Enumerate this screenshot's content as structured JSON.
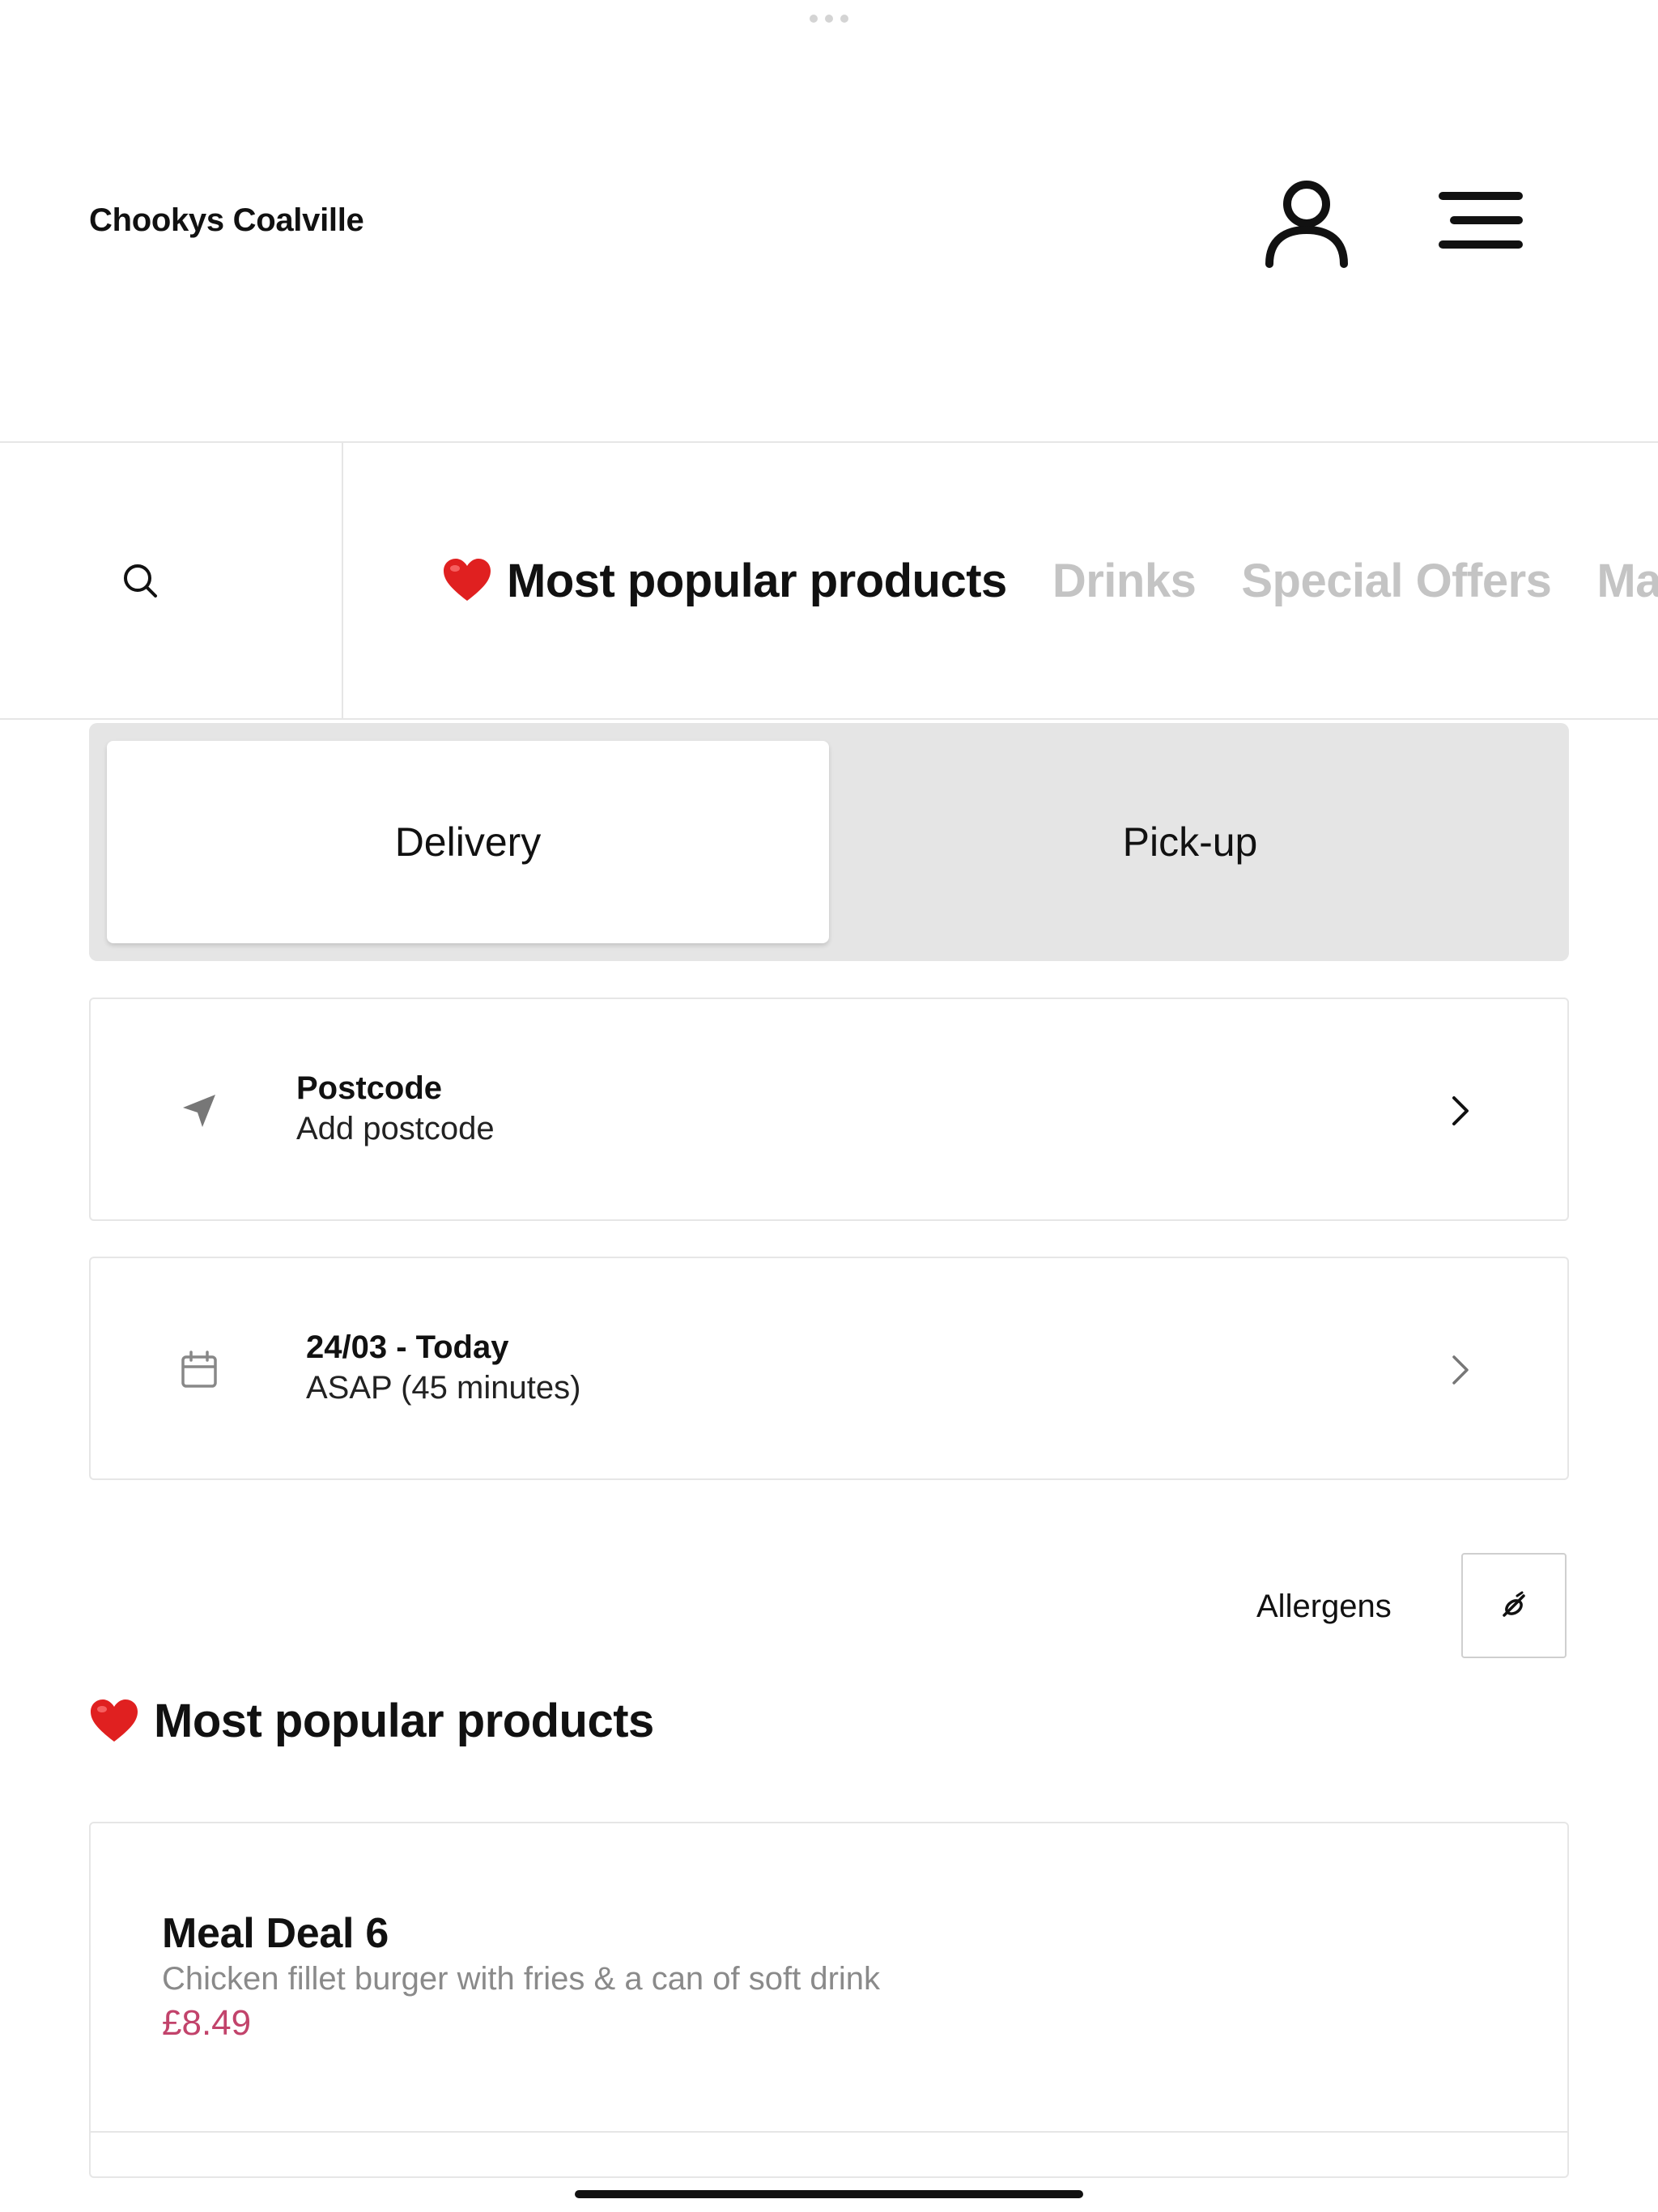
{
  "header": {
    "store_name": "Chookys Coalville"
  },
  "icons": {
    "account": "user-icon",
    "menu": "hamburger-menu-icon",
    "search": "search-icon",
    "favourite": "heart-icon",
    "location": "location-arrow-icon",
    "calendar": "calendar-icon",
    "chevron": "chevron-right-icon",
    "allergens": "allergens-icon"
  },
  "categories": [
    {
      "label": "Most popular products",
      "active": true
    },
    {
      "label": "Drinks",
      "active": false
    },
    {
      "label": "Special Offers",
      "active": false
    },
    {
      "label": "Ma",
      "active": false
    }
  ],
  "mode_toggle": {
    "delivery_label": "Delivery",
    "pickup_label": "Pick-up",
    "selected": "Delivery"
  },
  "postcode": {
    "title": "Postcode",
    "subtitle": "Add postcode"
  },
  "schedule": {
    "title": "24/03 - Today",
    "subtitle": "ASAP (45 minutes)"
  },
  "allergens": {
    "label": "Allergens"
  },
  "section": {
    "heading": "Most popular products"
  },
  "products": [
    {
      "name": "Meal Deal 6",
      "description": "Chicken fillet burger with fries & a can of soft drink",
      "price": "£8.49"
    }
  ],
  "colors": {
    "accent_price": "#c2436b",
    "heart": "#e02020",
    "inactive_tab": "#c4c4c4",
    "toggle_bg": "#e5e5e5"
  }
}
